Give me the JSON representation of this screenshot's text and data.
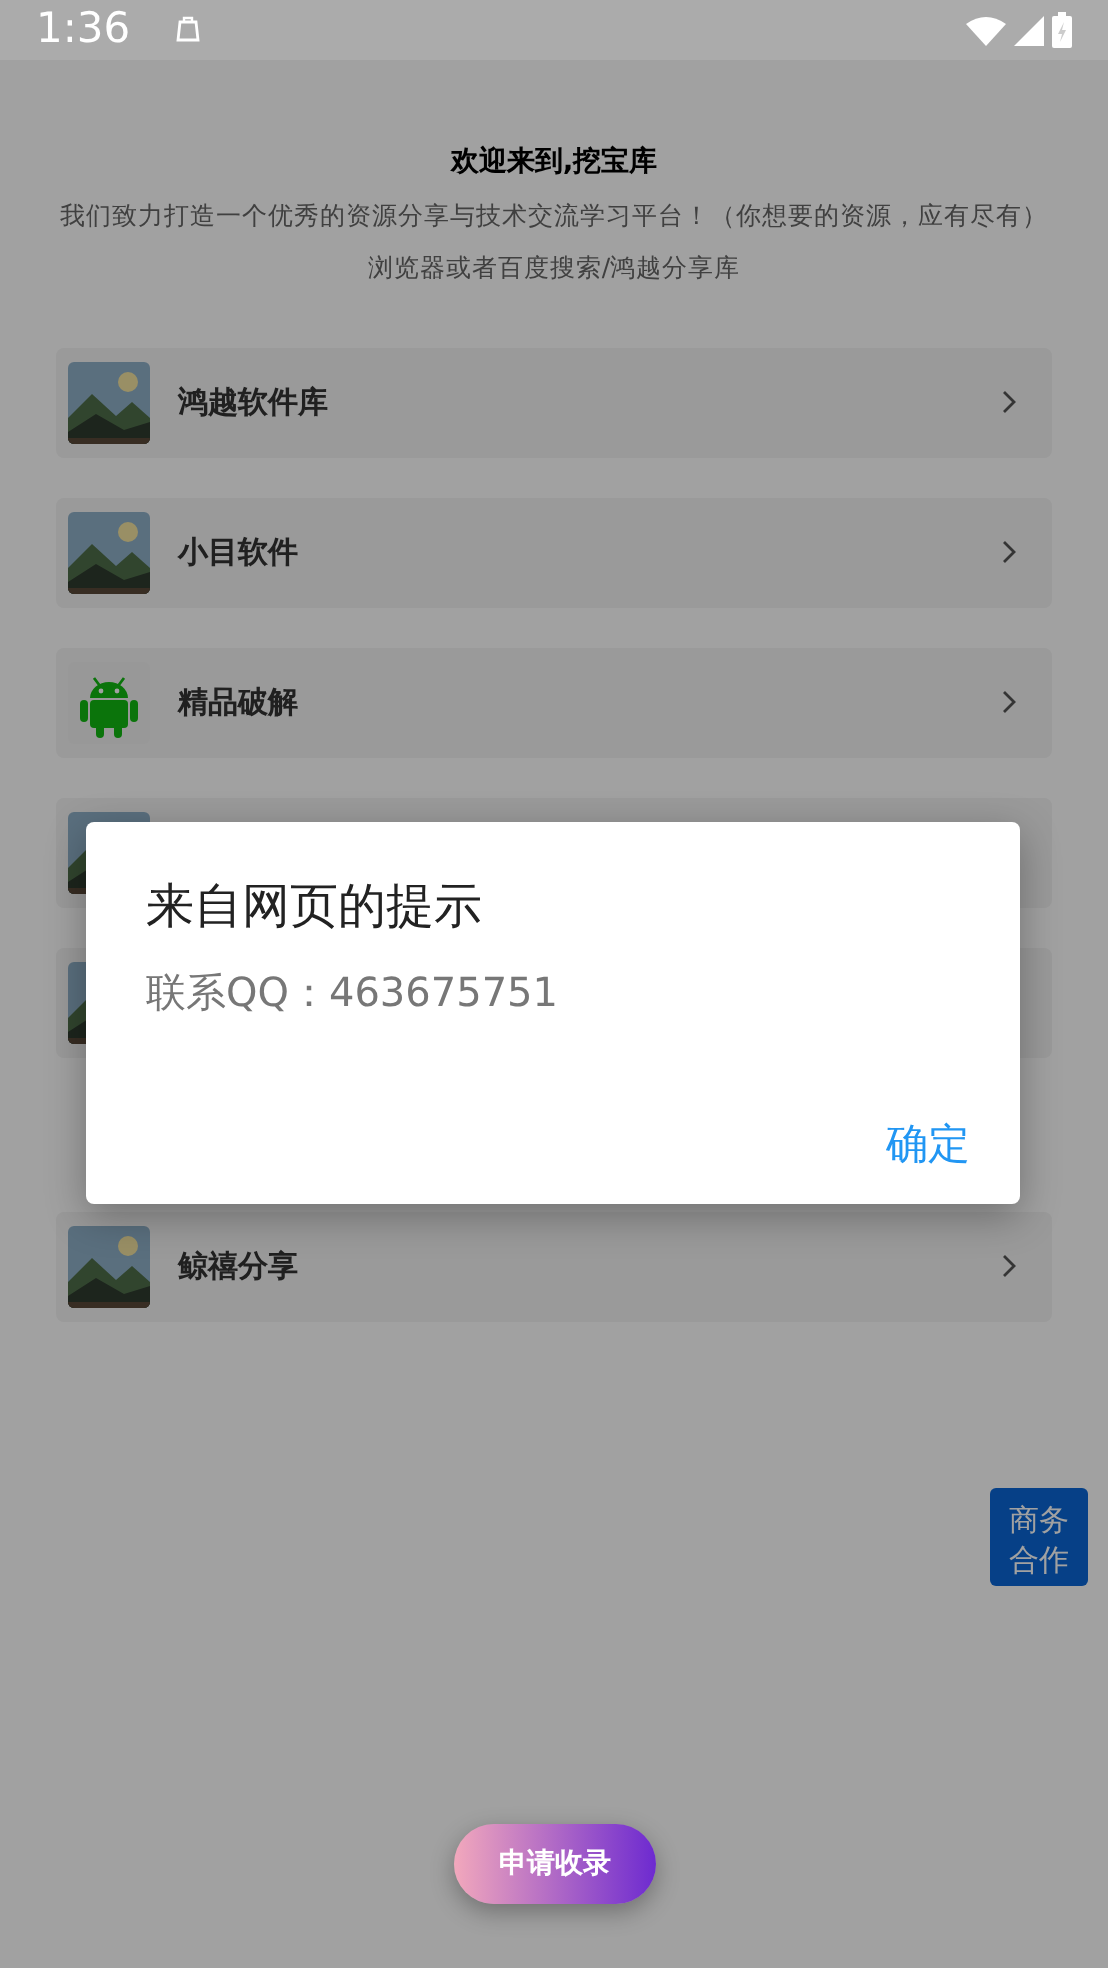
{
  "status_bar": {
    "time": "1:36"
  },
  "header": {
    "title": "欢迎来到,挖宝库",
    "subtitle": "我们致力打造一个优秀的资源分享与技术交流学习平台！（你想要的资源，应有尽有）",
    "hint": "浏览器或者百度搜索/鸿越分享库"
  },
  "list": [
    {
      "kind": "picture",
      "title": "鸿越软件库"
    },
    {
      "kind": "picture",
      "title": "小目软件"
    },
    {
      "kind": "android",
      "title": "精品破解"
    },
    {
      "kind": "covered"
    },
    {
      "kind": "covered"
    },
    {
      "kind": "gap"
    },
    {
      "kind": "picture",
      "title": "鲸禧分享"
    }
  ],
  "float_button": {
    "label_lines": [
      "商务",
      "合作"
    ]
  },
  "apply_button": {
    "label": "申请收录"
  },
  "dialog": {
    "title": "来自网页的提示",
    "message": "联系QQ：463675751",
    "button": "确定"
  }
}
